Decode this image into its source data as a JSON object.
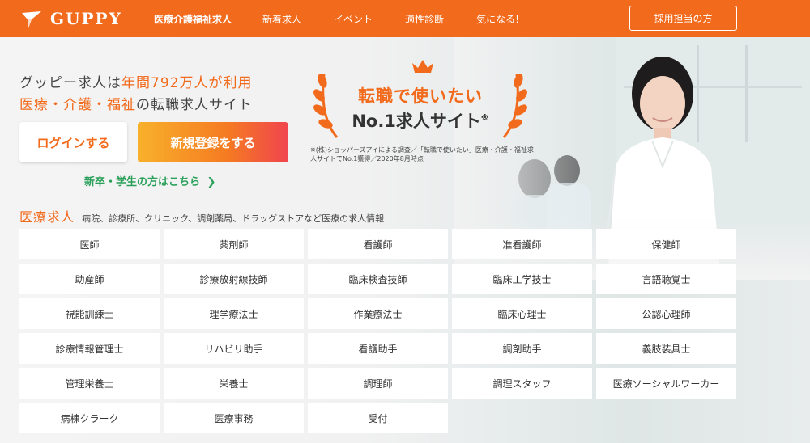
{
  "header": {
    "logo_text": "GUPPY",
    "nav": [
      {
        "label": "医療介護福祉求人",
        "active": true
      },
      {
        "label": "新着求人",
        "active": false
      },
      {
        "label": "イベント",
        "active": false
      },
      {
        "label": "適性診断",
        "active": false
      },
      {
        "label": "気になる!",
        "active": false
      }
    ],
    "employer_button": "採用担当の方"
  },
  "hero": {
    "tagline_line1_a": "グッピー求人は",
    "tagline_line1_b": "年間792万人が利用",
    "tagline_line2_a": "医療・介護・福祉",
    "tagline_line2_b": "の転職求人サイト",
    "login_button": "ログインする",
    "register_button": "新規登録をする",
    "student_link": "新卒・学生の方はこちら",
    "award_title": "転職で使いたい",
    "award_sub": "No.1求人サイト",
    "award_mark": "※",
    "award_note": "※(株)ショッパーズアイによる調査／「転職で使いたい」医療・介護・福祉求人サイトでNo.1獲得／2020年8月時点"
  },
  "jobs": {
    "title": "医療求人",
    "description": "病院、診療所、クリニック、調剤薬局、ドラッグストアなど医療の求人情報",
    "items": [
      "医師",
      "薬剤師",
      "看護師",
      "准看護師",
      "保健師",
      "助産師",
      "診療放射線技師",
      "臨床検査技師",
      "臨床工学技士",
      "言語聴覚士",
      "視能訓練士",
      "理学療法士",
      "作業療法士",
      "臨床心理士",
      "公認心理師",
      "診療情報管理士",
      "リハビリ助手",
      "看護助手",
      "調剤助手",
      "義肢装具士",
      "管理栄養士",
      "栄養士",
      "調理師",
      "調理スタッフ",
      "医療ソーシャルワーカー",
      "病棟クラーク",
      "医療事務",
      "受付"
    ]
  },
  "colors": {
    "brand_orange": "#f26a1b",
    "student_green": "#2aa05a"
  }
}
